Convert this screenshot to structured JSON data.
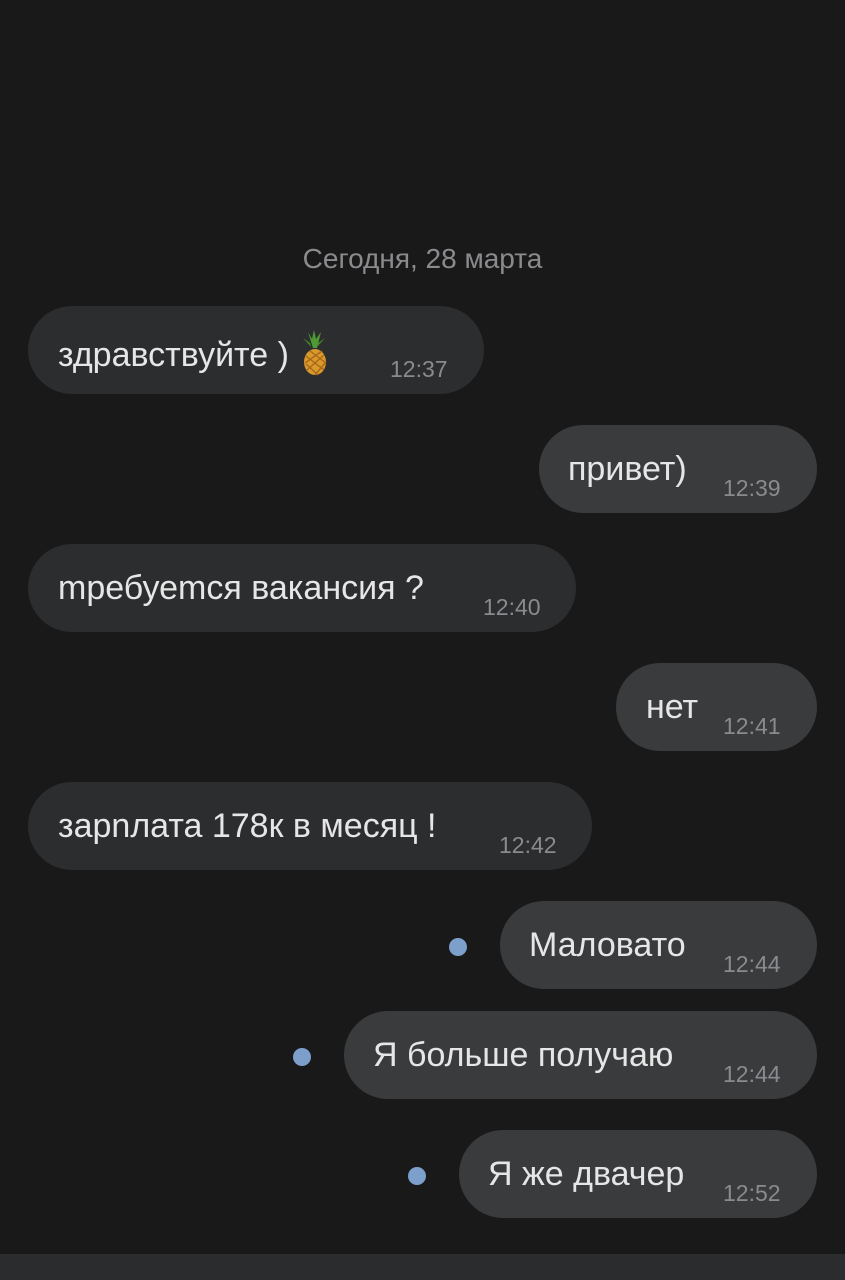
{
  "date_separator": "Сегодня, 28 марта",
  "unread_dot_color": "#7d9fcb",
  "messages": [
    {
      "direction": "incoming",
      "text": "здравствуйте )",
      "emoji": "pineapple",
      "time": "12:37"
    },
    {
      "direction": "outgoing",
      "text": "привет)",
      "time": "12:39"
    },
    {
      "direction": "incoming",
      "text": "mребуеmся вакансия ?",
      "time": "12:40"
    },
    {
      "direction": "outgoing",
      "text": "нет",
      "time": "12:41"
    },
    {
      "direction": "incoming",
      "text": "зарnлата 178к в месяц !",
      "time": "12:42"
    },
    {
      "direction": "outgoing",
      "text": "Маловато",
      "time": "12:44",
      "unread": true
    },
    {
      "direction": "outgoing",
      "text": "Я больше получаю",
      "time": "12:44",
      "unread": true
    },
    {
      "direction": "outgoing",
      "text": "Я же двачер",
      "time": "12:52",
      "unread": true
    }
  ]
}
